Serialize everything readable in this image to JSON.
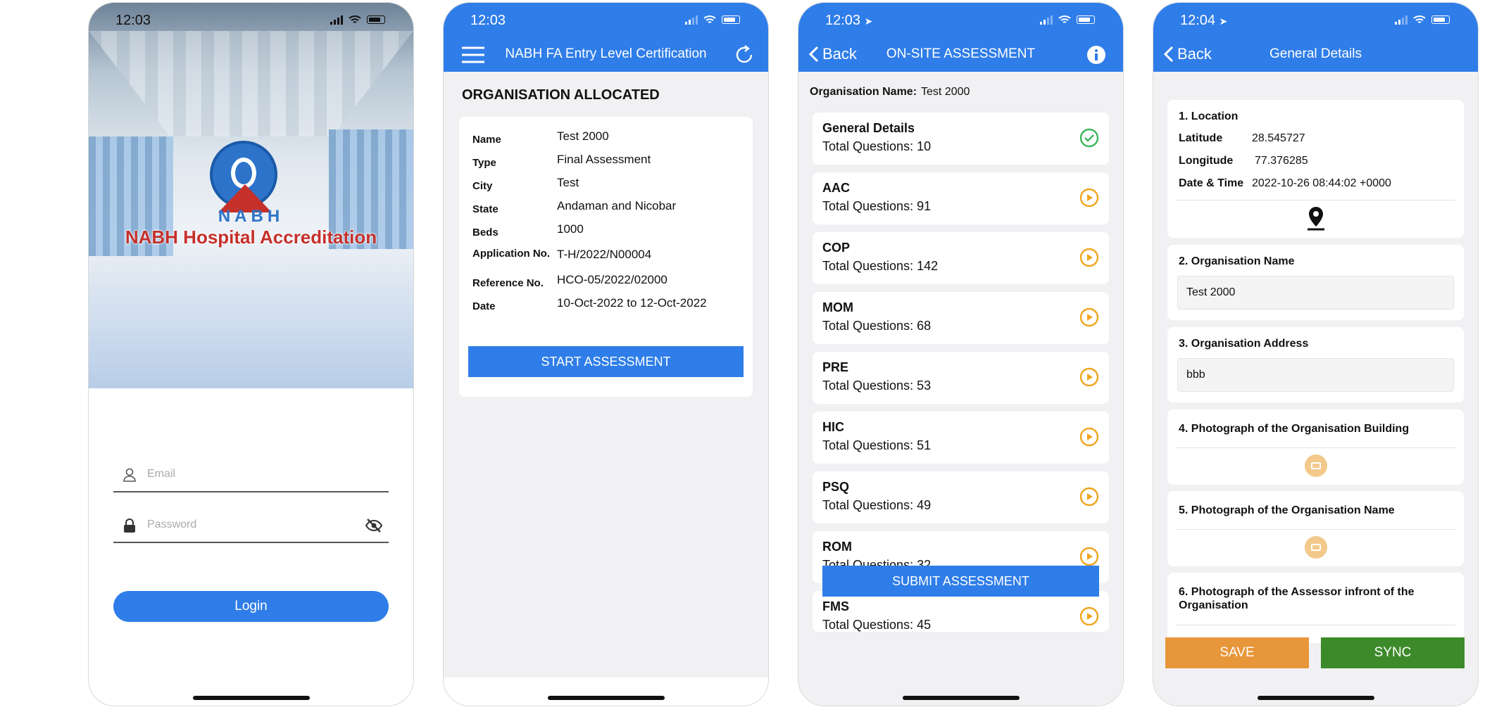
{
  "colors": {
    "primary": "#2f7de8",
    "success": "#3cb55a",
    "pending": "#f0a51f",
    "save": "#e8963a",
    "sync": "#3d8a2a"
  },
  "screen1": {
    "time": "12:03",
    "brand": "NABH",
    "title": "NABH Hospital Accreditation",
    "email_placeholder": "Email",
    "password_placeholder": "Password",
    "login_label": "Login"
  },
  "screen2": {
    "time": "12:03",
    "header_title": "NABH FA Entry Level Certification",
    "section_title": "ORGANISATION ALLOCATED",
    "rows": [
      {
        "label": "Name",
        "value": "Test 2000"
      },
      {
        "label": "Type",
        "value": "Final Assessment"
      },
      {
        "label": "City",
        "value": "Test"
      },
      {
        "label": "State",
        "value": "Andaman and Nicobar"
      },
      {
        "label": "Beds",
        "value": "1000"
      },
      {
        "label": "Application No.",
        "value": "T-H/2022/N00004"
      },
      {
        "label": "Reference No.",
        "value": "HCO-05/2022/02000"
      },
      {
        "label": "Date",
        "value": "10-Oct-2022 to 12-Oct-2022"
      }
    ],
    "start_label": "START ASSESSMENT"
  },
  "screen3": {
    "time": "12:03",
    "back_label": "Back",
    "header_title": "ON-SITE ASSESSMENT",
    "org_label": "Organisation Name:",
    "org_value": "Test 2000",
    "chapters": [
      {
        "name": "General Details",
        "total": "Total Questions: 10",
        "status": "done"
      },
      {
        "name": "AAC",
        "total": "Total Questions: 91",
        "status": "pending"
      },
      {
        "name": "COP",
        "total": "Total Questions: 142",
        "status": "pending"
      },
      {
        "name": "MOM",
        "total": "Total Questions: 68",
        "status": "pending"
      },
      {
        "name": "PRE",
        "total": "Total Questions: 53",
        "status": "pending"
      },
      {
        "name": "HIC",
        "total": "Total Questions: 51",
        "status": "pending"
      },
      {
        "name": "PSQ",
        "total": "Total Questions: 49",
        "status": "pending"
      },
      {
        "name": "ROM",
        "total": "Total Questions: 32",
        "status": "pending"
      },
      {
        "name": "FMS",
        "total": "Total Questions: 45",
        "status": "pending"
      }
    ],
    "submit_label": "SUBMIT ASSESSMENT"
  },
  "screen4": {
    "time": "12:04",
    "back_label": "Back",
    "header_title": "General Details",
    "q1": "1. Location",
    "latitude_label": "Latitude",
    "latitude_value": "28.545727",
    "longitude_label": "Longitude",
    "longitude_value": "77.376285",
    "datetime_label": "Date & Time",
    "datetime_value": "2022-10-26 08:44:02 +0000",
    "q2": "2. Organisation Name",
    "q2_value": "Test 2000",
    "q3": "3. Organisation Address",
    "q3_value": "bbb",
    "q4": "4. Photograph of the Organisation Building",
    "q5": "5. Photograph of the Organisation Name",
    "q6": "6. Photograph of the Assessor infront of the Organisation",
    "save_label": "SAVE",
    "sync_label": "SYNC"
  }
}
